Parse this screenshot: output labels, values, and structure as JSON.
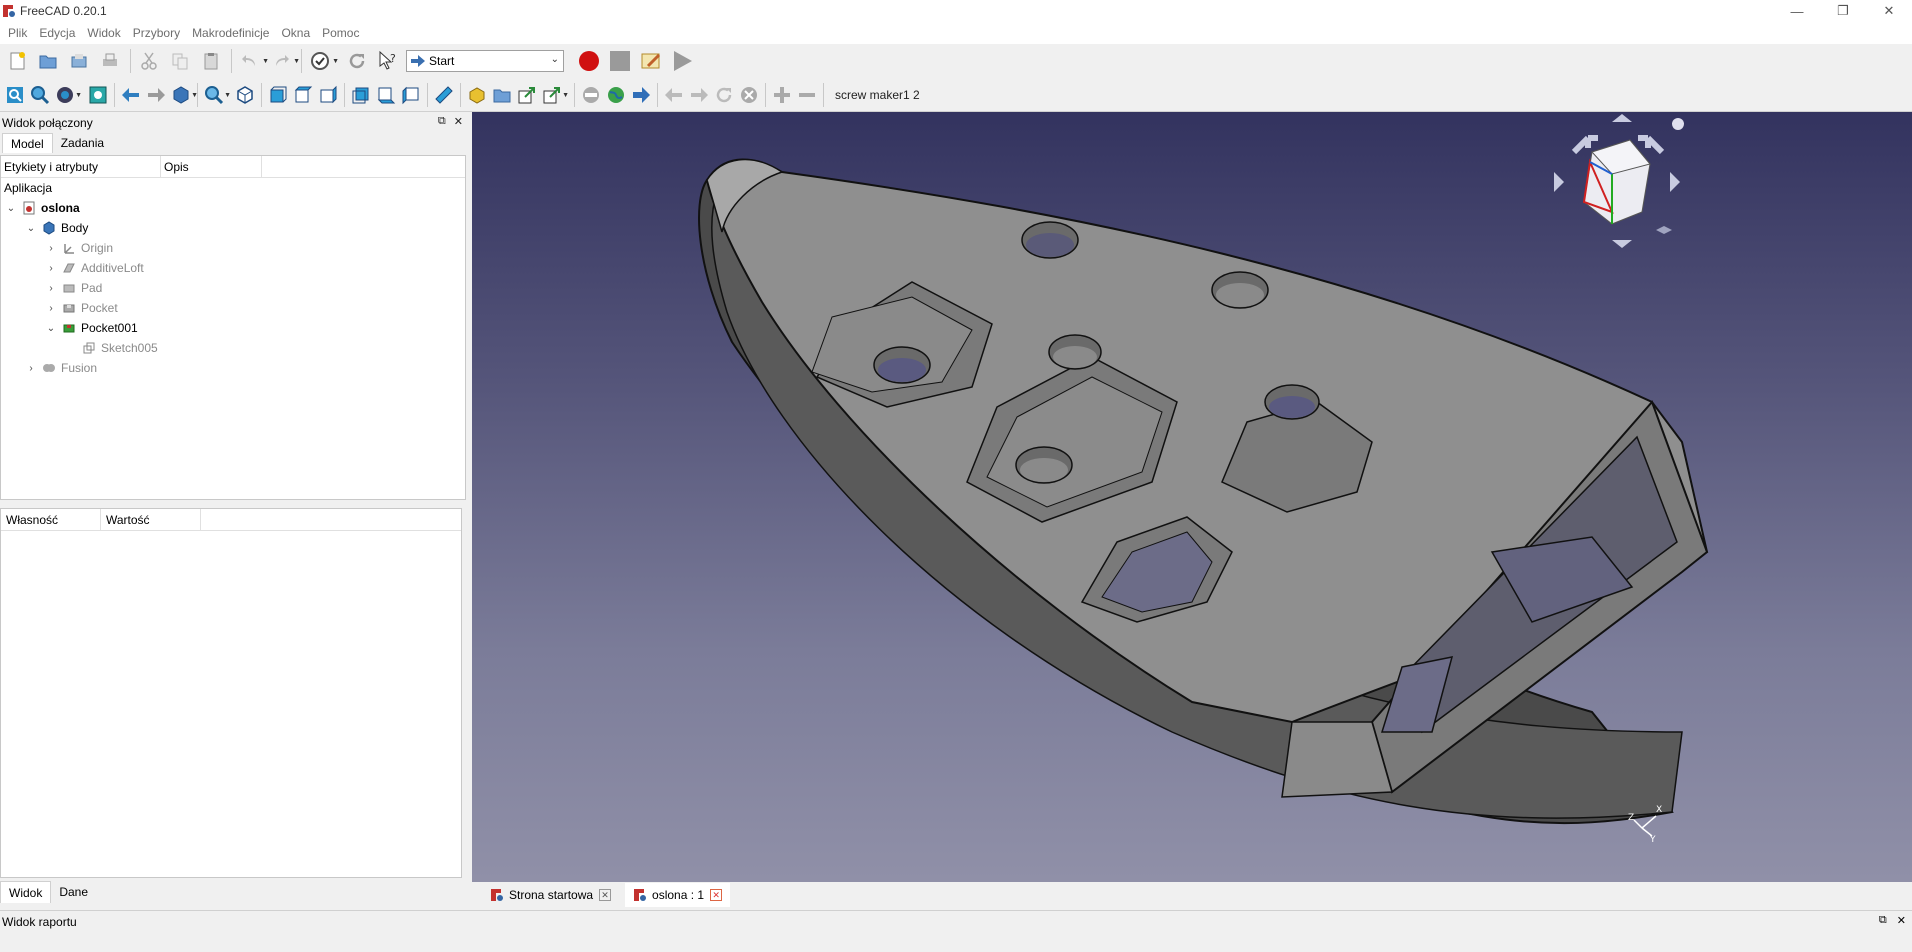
{
  "window": {
    "title": "FreeCAD 0.20.1"
  },
  "menu": [
    "Plik",
    "Edycja",
    "Widok",
    "Przybory",
    "Makrodefinicje",
    "Okna",
    "Pomoc"
  ],
  "workbench": {
    "selected": "Start"
  },
  "macro": {
    "name": "screw maker1 2"
  },
  "combo_view": {
    "title": "Widok połączony",
    "tabs": [
      "Model",
      "Zadania"
    ],
    "tree_headers": [
      "Etykiety i atrybuty",
      "Opis"
    ],
    "root_label": "Aplikacja",
    "tree": [
      {
        "label": "oslona",
        "expander": "⌄",
        "icon": "document-icon"
      },
      {
        "label": "Body",
        "expander": "⌄",
        "icon": "body-icon"
      },
      {
        "label": "Origin",
        "expander": "›",
        "icon": "origin-icon"
      },
      {
        "label": "AdditiveLoft",
        "expander": "›",
        "icon": "loft-icon"
      },
      {
        "label": "Pad",
        "expander": "›",
        "icon": "pad-icon"
      },
      {
        "label": "Pocket",
        "expander": "›",
        "icon": "pocket-icon"
      },
      {
        "label": "Pocket001",
        "expander": "⌄",
        "icon": "pocket-icon"
      },
      {
        "label": "Sketch005",
        "expander": "",
        "icon": "sketch-icon"
      },
      {
        "label": "Fusion",
        "expander": "›",
        "icon": "fusion-icon"
      }
    ],
    "property_headers": [
      "Własność",
      "Wartość"
    ],
    "property_tabs": [
      "Widok",
      "Dane"
    ]
  },
  "documents": [
    {
      "label": "Strona startowa",
      "active": false
    },
    {
      "label": "oslona : 1",
      "active": true
    }
  ],
  "report_view": {
    "title": "Widok raportu"
  },
  "colors": {
    "bg_top": "#33335f",
    "bg_bottom": "#9090a8",
    "record": "#d01010"
  }
}
